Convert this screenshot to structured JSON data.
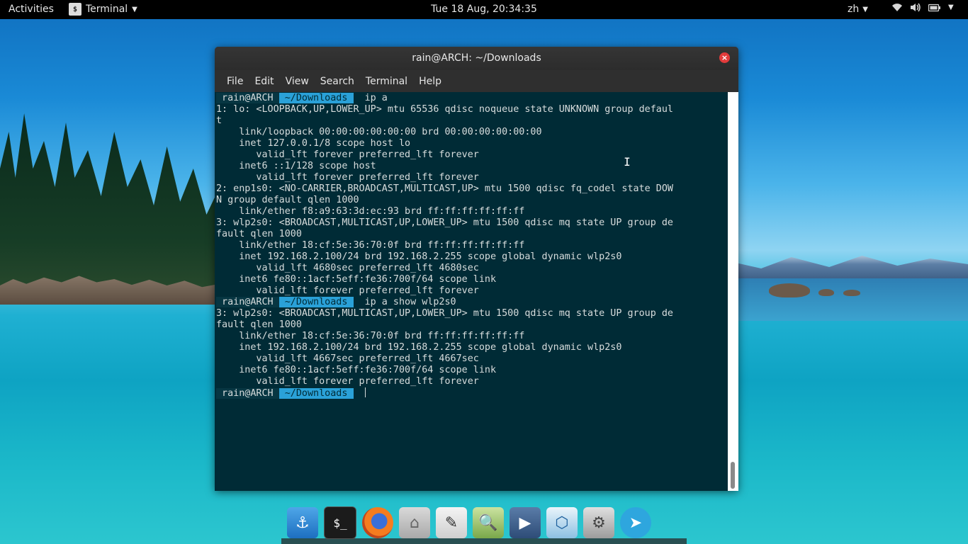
{
  "topbar": {
    "activities": "Activities",
    "app_name": "Terminal",
    "clock": "Tue 18 Aug, 20:34:35",
    "input_lang": "zh"
  },
  "window": {
    "title": "rain@ARCH: ~/Downloads",
    "menu": [
      "File",
      "Edit",
      "View",
      "Search",
      "Terminal",
      "Help"
    ]
  },
  "terminal": {
    "prompt_user": " rain@ARCH ",
    "prompt_path": " ~/Downloads ",
    "prompt_arrow": " ",
    "lines": [
      {
        "type": "prompt",
        "cmd": " ip a"
      },
      {
        "type": "text",
        "text": "1: lo: <LOOPBACK,UP,LOWER_UP> mtu 65536 qdisc noqueue state UNKNOWN group defaul"
      },
      {
        "type": "text",
        "text": "t"
      },
      {
        "type": "text",
        "text": "    link/loopback 00:00:00:00:00:00 brd 00:00:00:00:00:00"
      },
      {
        "type": "text",
        "text": "    inet 127.0.0.1/8 scope host lo"
      },
      {
        "type": "text",
        "text": "       valid_lft forever preferred_lft forever"
      },
      {
        "type": "text",
        "text": "    inet6 ::1/128 scope host"
      },
      {
        "type": "text",
        "text": "       valid_lft forever preferred_lft forever"
      },
      {
        "type": "text",
        "text": "2: enp1s0: <NO-CARRIER,BROADCAST,MULTICAST,UP> mtu 1500 qdisc fq_codel state DOW"
      },
      {
        "type": "text",
        "text": "N group default qlen 1000"
      },
      {
        "type": "text",
        "text": "    link/ether f8:a9:63:3d:ec:93 brd ff:ff:ff:ff:ff:ff"
      },
      {
        "type": "text",
        "text": "3: wlp2s0: <BROADCAST,MULTICAST,UP,LOWER_UP> mtu 1500 qdisc mq state UP group de"
      },
      {
        "type": "text",
        "text": "fault qlen 1000"
      },
      {
        "type": "text",
        "text": "    link/ether 18:cf:5e:36:70:0f brd ff:ff:ff:ff:ff:ff"
      },
      {
        "type": "text",
        "text": "    inet 192.168.2.100/24 brd 192.168.2.255 scope global dynamic wlp2s0"
      },
      {
        "type": "text",
        "text": "       valid_lft 4680sec preferred_lft 4680sec"
      },
      {
        "type": "text",
        "text": "    inet6 fe80::1acf:5eff:fe36:700f/64 scope link"
      },
      {
        "type": "text",
        "text": "       valid_lft forever preferred_lft forever"
      },
      {
        "type": "prompt",
        "cmd": " ip a show wlp2s0"
      },
      {
        "type": "text",
        "text": "3: wlp2s0: <BROADCAST,MULTICAST,UP,LOWER_UP> mtu 1500 qdisc mq state UP group de"
      },
      {
        "type": "text",
        "text": "fault qlen 1000"
      },
      {
        "type": "text",
        "text": "    link/ether 18:cf:5e:36:70:0f brd ff:ff:ff:ff:ff:ff"
      },
      {
        "type": "text",
        "text": "    inet 192.168.2.100/24 brd 192.168.2.255 scope global dynamic wlp2s0"
      },
      {
        "type": "text",
        "text": "       valid_lft 4667sec preferred_lft 4667sec"
      },
      {
        "type": "text",
        "text": "    inet6 fe80::1acf:5eff:fe36:700f/64 scope link"
      },
      {
        "type": "text",
        "text": "       valid_lft forever preferred_lft forever"
      },
      {
        "type": "prompt",
        "cmd": " ",
        "cursor": true
      }
    ],
    "colors": {
      "background": "#002b36",
      "path_bg": "#2aa1d8",
      "text": "#d7dcdc"
    }
  },
  "dock": {
    "icons": [
      {
        "name": "anchor-app-icon",
        "glyph": "⚓",
        "cls": "di-anchor"
      },
      {
        "name": "terminal-app-icon",
        "glyph": "$_",
        "cls": "di-terminal"
      },
      {
        "name": "firefox-app-icon",
        "glyph": "",
        "cls": "di-firefox"
      },
      {
        "name": "files-app-icon",
        "glyph": "⌂",
        "cls": "di-files"
      },
      {
        "name": "text-editor-app-icon",
        "glyph": "✎",
        "cls": "di-editor"
      },
      {
        "name": "image-viewer-app-icon",
        "glyph": "🔍",
        "cls": "di-image"
      },
      {
        "name": "video-player-app-icon",
        "glyph": "▶",
        "cls": "di-video"
      },
      {
        "name": "virtualbox-app-icon",
        "glyph": "⬡",
        "cls": "di-vbox"
      },
      {
        "name": "system-tools-app-icon",
        "glyph": "⚙",
        "cls": "di-tools"
      },
      {
        "name": "telegram-app-icon",
        "glyph": "➤",
        "cls": "di-telegram"
      }
    ]
  }
}
